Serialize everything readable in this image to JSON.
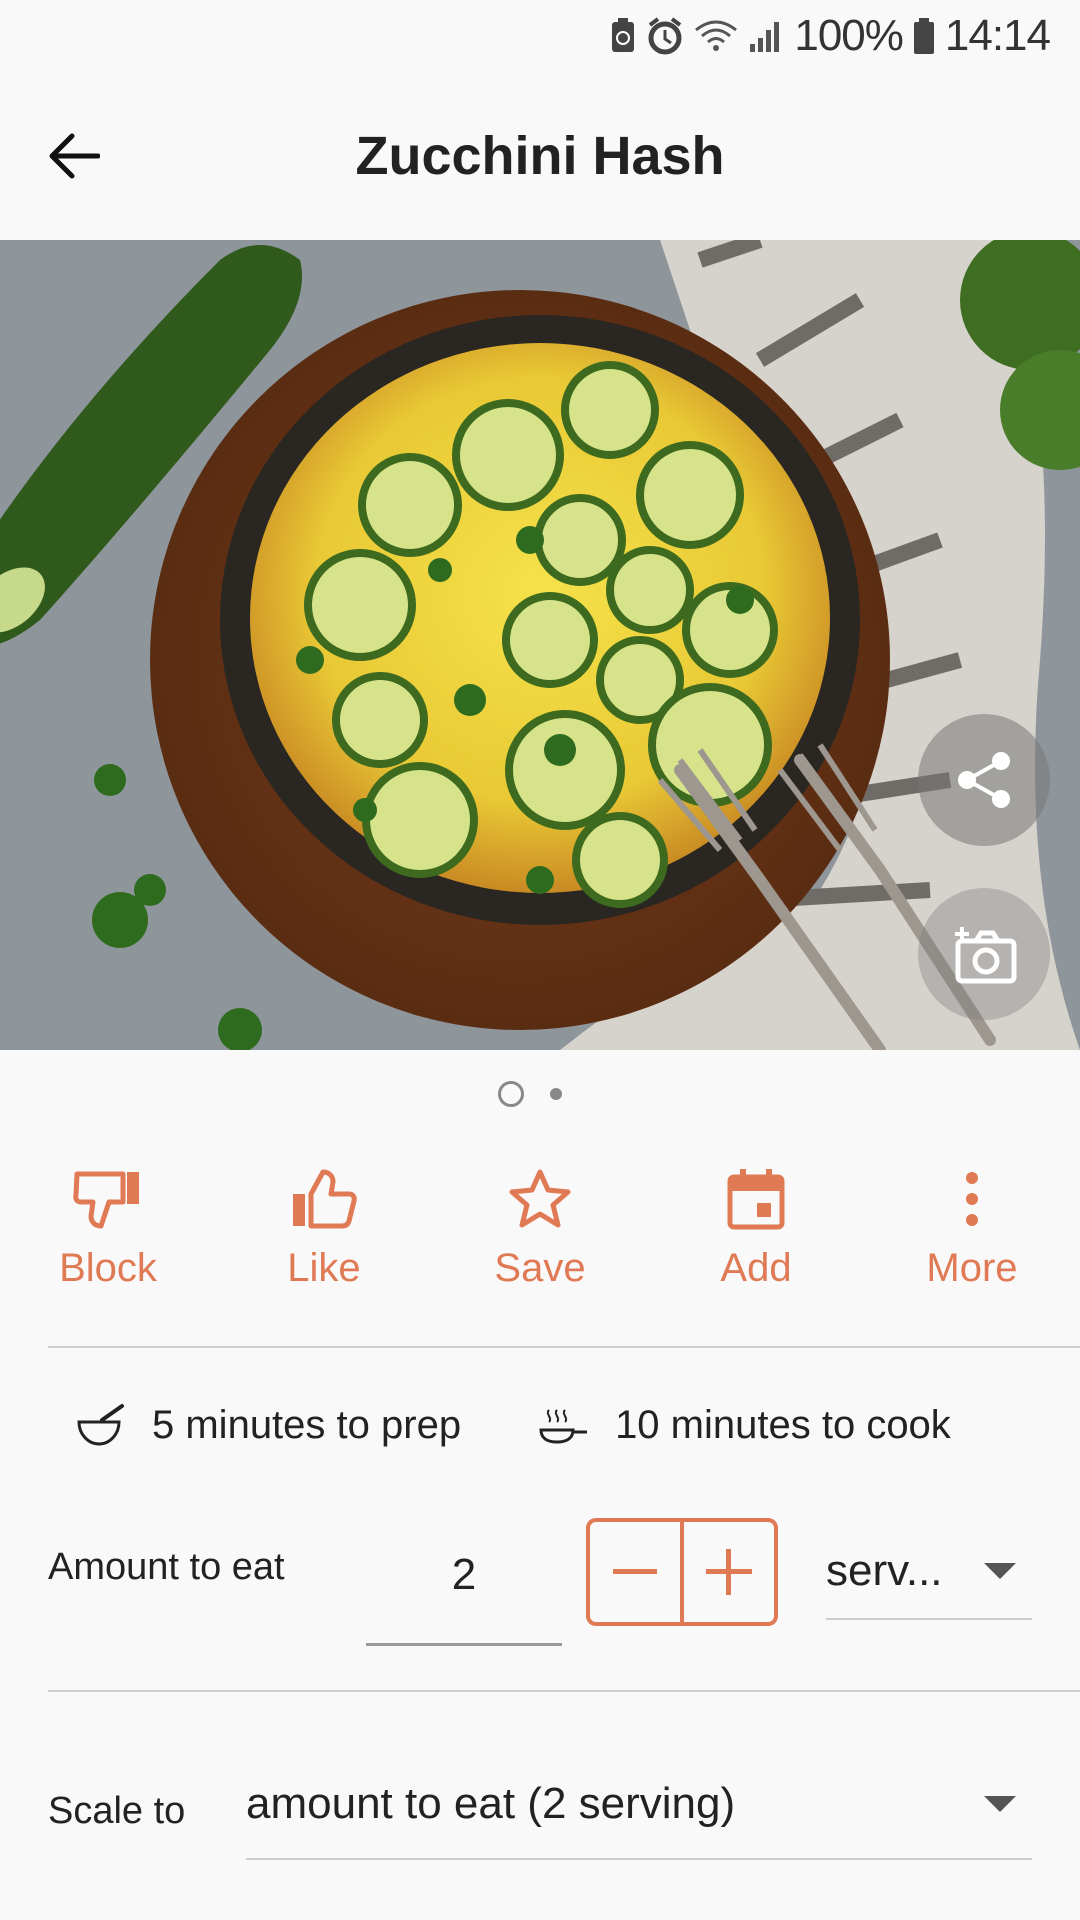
{
  "status_bar": {
    "battery": "100%",
    "time": "14:14"
  },
  "app_bar": {
    "title": "Zucchini Hash"
  },
  "hero": {
    "pager_count": 2,
    "pager_active": 0
  },
  "actions": [
    {
      "label": "Block",
      "icon": "thumbs-down-icon"
    },
    {
      "label": "Like",
      "icon": "thumbs-up-icon"
    },
    {
      "label": "Save",
      "icon": "star-icon"
    },
    {
      "label": "Add",
      "icon": "calendar-icon"
    },
    {
      "label": "More",
      "icon": "more-vertical-icon"
    }
  ],
  "times": {
    "prep": "5 minutes to prep",
    "cook": "10 minutes to cook"
  },
  "amount": {
    "label": "Amount to eat",
    "value": "2",
    "unit": "serv..."
  },
  "scale": {
    "label": "Scale to",
    "value": "amount to eat (2 serving)"
  },
  "colors": {
    "accent": "#e07a55",
    "background": "#f9f9f9"
  }
}
